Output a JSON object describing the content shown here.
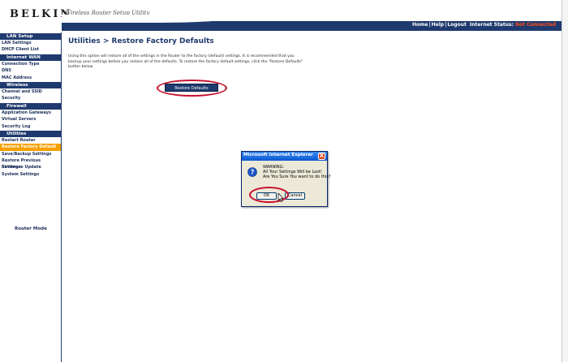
{
  "header": {
    "logo": "BELKIN",
    "tagline": "Wireless Router Setup Utility",
    "nav": [
      "Home",
      "Help",
      "Logout"
    ],
    "status_label": "Internet Status:",
    "status_value": "Not Connected"
  },
  "sidebar": {
    "sections": [
      {
        "title": "LAN Setup",
        "items": [
          "LAN Settings",
          "DHCP Client List"
        ]
      },
      {
        "title": "Internet WAN",
        "items": [
          "Connection Type",
          "DNS",
          "MAC Address"
        ]
      },
      {
        "title": "Wireless",
        "items": [
          "Channel and SSID",
          "Security"
        ]
      },
      {
        "title": "Firewall",
        "items": [
          "Application Gateways",
          "Virtual Servers",
          "Security Log"
        ]
      },
      {
        "title": "Utilities",
        "items": [
          "Restart Router",
          "Restore Factory Default",
          "Save/Backup Settings",
          "Restore Previous Settings",
          "Firmware Update",
          "System Settings"
        ]
      }
    ],
    "active_item": "Restore Factory Default",
    "mode_label": "Router Mode"
  },
  "main": {
    "title": "Utilities > Restore Factory Defaults",
    "description": "Using this option will restore all of the settings in the Router to the factory (default) settings. It is recommended that you backup your settings before you restore all of the defaults. To restore the factory default settings, click the \"Restore Defaults\" button below.",
    "restore_button": "Restore Defaults"
  },
  "dialog": {
    "title": "Microsoft Internet Explorer",
    "close_glyph": "X",
    "message_lines": [
      "WARNING:",
      "All Your Settings Will be Lost!",
      "Are You Sure You want to do this?"
    ],
    "ok_label": "OK",
    "cancel_label": "Cancel",
    "icon": "question-icon"
  },
  "colors": {
    "nav_blue": "#1f3a6e",
    "active_orange": "#f7a000",
    "highlight_ring": "#c8102e",
    "status_red": "#ff4d1a"
  }
}
